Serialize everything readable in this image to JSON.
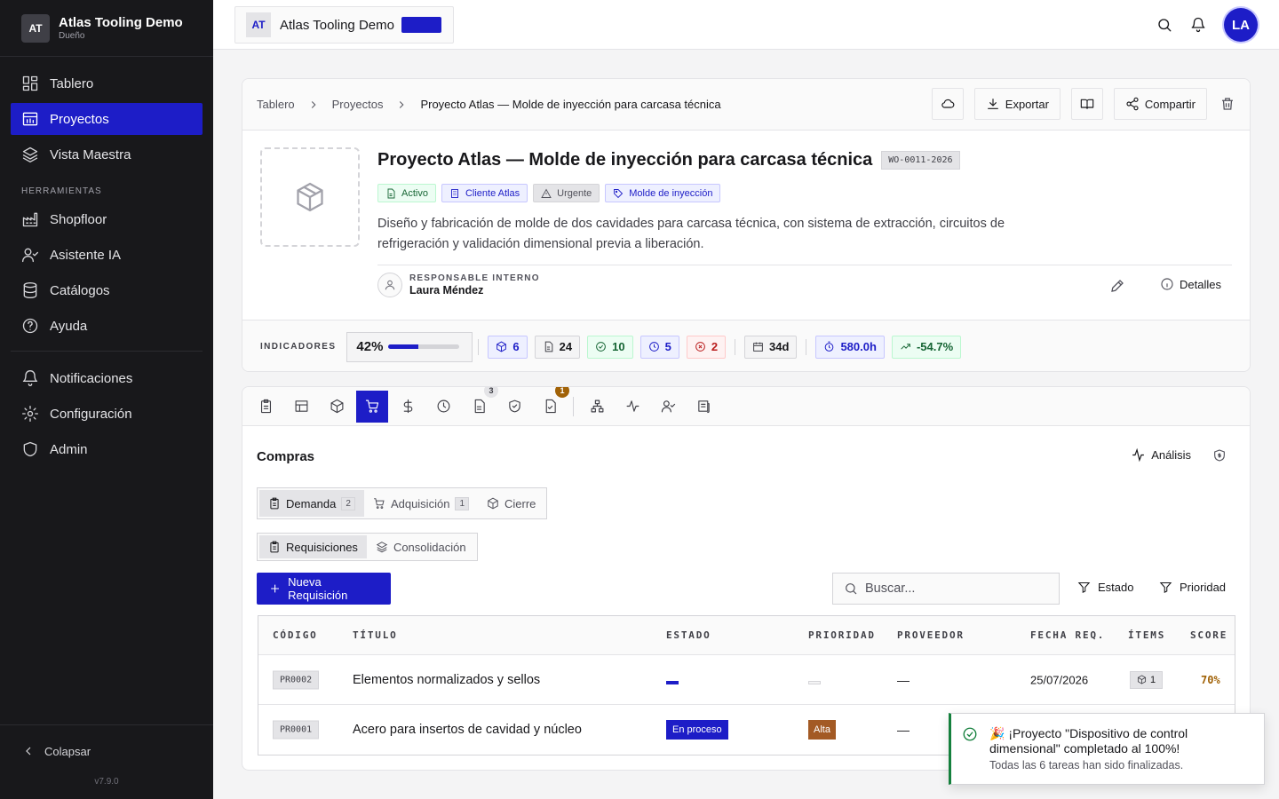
{
  "workspace": {
    "badge": "AT",
    "name": "Atlas Tooling Demo",
    "role": "Dueño"
  },
  "sidebar": {
    "main": [
      {
        "label": "Tablero",
        "icon": "dashboard-icon"
      },
      {
        "label": "Proyectos",
        "icon": "projects-icon",
        "active": true
      },
      {
        "label": "Vista Maestra",
        "icon": "layers-icon"
      }
    ],
    "tools_header": "HERRAMIENTAS",
    "tools": [
      {
        "label": "Shopfloor",
        "icon": "factory-icon"
      },
      {
        "label": "Asistente IA",
        "icon": "assistant-icon"
      },
      {
        "label": "Catálogos",
        "icon": "database-icon"
      },
      {
        "label": "Ayuda",
        "icon": "help-icon"
      }
    ],
    "system": [
      {
        "label": "Notificaciones",
        "icon": "bell-icon"
      },
      {
        "label": "Configuración",
        "icon": "gear-icon"
      },
      {
        "label": "Admin",
        "icon": "shield-icon"
      }
    ],
    "collapse_label": "Colapsar",
    "version": "v7.9.0"
  },
  "topbar": {
    "project_badge": "AT",
    "project_name": "Atlas Tooling Demo",
    "chip_color": "#1d1dc7",
    "avatar_initials": "LA"
  },
  "breadcrumb": [
    "Tablero",
    "Proyectos",
    "Proyecto Atlas — Molde de inyección para carcasa técnica"
  ],
  "header_actions": {
    "export": "Exportar",
    "share": "Compartir"
  },
  "project": {
    "title": "Proyecto Atlas — Molde de inyección para carcasa técnica",
    "code": "WO-0011-2026",
    "tags": [
      {
        "label": "Activo",
        "style": "green",
        "icon": "document-icon"
      },
      {
        "label": "Cliente Atlas",
        "style": "blue",
        "icon": "building-icon"
      },
      {
        "label": "Urgente",
        "style": "grey",
        "icon": "warning-icon"
      },
      {
        "label": "Molde de inyección",
        "style": "blue",
        "icon": "tag-icon"
      }
    ],
    "description": "Diseño y fabricación de molde de dos cavidades para carcasa técnica, con sistema de extracción, circuitos de refrigeración y validación dimensional previa a liberación.",
    "responsible_label": "RESPONSABLE INTERNO",
    "responsible_name": "Laura Méndez",
    "details_label": "Detalles"
  },
  "indicators": {
    "label": "INDICADORES",
    "progress_label": "42%",
    "progress_value": 0.42,
    "group1": [
      {
        "value": "6",
        "style": "blue",
        "icon": "cube-icon"
      },
      {
        "value": "24",
        "style": "grey",
        "icon": "document-icon"
      },
      {
        "value": "10",
        "style": "green",
        "icon": "check-circle-icon"
      },
      {
        "value": "5",
        "style": "blue",
        "icon": "clock-icon"
      },
      {
        "value": "2",
        "style": "red",
        "icon": "x-circle-icon"
      }
    ],
    "group2": [
      {
        "value": "34d",
        "style": "grey",
        "icon": "calendar-icon"
      }
    ],
    "group3": [
      {
        "value": "580.0h",
        "style": "blue",
        "icon": "timer-icon"
      },
      {
        "value": "-54.7%",
        "style": "green",
        "icon": "trend-up-icon"
      }
    ]
  },
  "module_tabs": {
    "badge_1": "3",
    "badge_2": "1"
  },
  "purchases": {
    "title": "Compras",
    "analysis_label": "Análisis",
    "stage_tabs": [
      {
        "label": "Demanda",
        "count": "2",
        "active": true
      },
      {
        "label": "Adquisición",
        "count": "1"
      },
      {
        "label": "Cierre"
      }
    ],
    "sub_tabs": [
      {
        "label": "Requisiciones",
        "active": true
      },
      {
        "label": "Consolidación"
      }
    ],
    "new_button": "Nueva Requisición",
    "search_placeholder": "Buscar...",
    "filter_status": "Estado",
    "filter_priority": "Prioridad",
    "columns": [
      "CÓDIGO",
      "TÍTULO",
      "ESTADO",
      "PRIORIDAD",
      "PROVEEDOR",
      "FECHA REQ.",
      "ÍTEMS",
      "SCORE"
    ],
    "rows": [
      {
        "code": "PR0002",
        "title": "Elementos normalizados y sellos",
        "status": "",
        "priority": "",
        "supplier": "—",
        "date": "25/07/2026",
        "items": "1",
        "score": "70%"
      },
      {
        "code": "PR0001",
        "title": "Acero para insertos de cavidad y núcleo",
        "status": "En proceso",
        "priority": "Alta",
        "supplier": "—",
        "date": "",
        "items": "",
        "score": ""
      }
    ]
  },
  "toast": {
    "title": "🎉 ¡Proyecto \"Dispositivo de control dimensional\" completado al 100%!",
    "description": "Todas las 6 tareas han sido finalizadas."
  }
}
